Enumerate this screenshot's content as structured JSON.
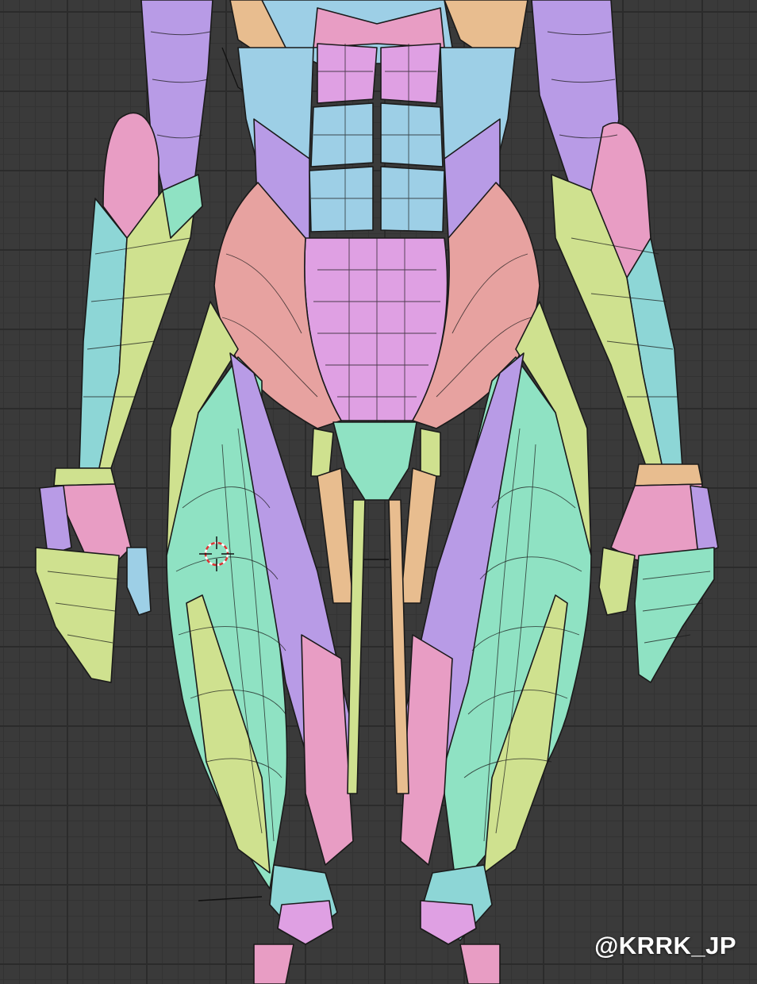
{
  "watermark": "@KRRK_JP",
  "colors": {
    "viewport_bg": "#3a3a3a",
    "grid_major": "#2b2b2b",
    "mint": "#8fe2c3",
    "teal": "#8dd6d6",
    "light_blue": "#9dcfe6",
    "violet": "#b89be6",
    "lilac": "#dfa0e3",
    "pink": "#e89dc4",
    "salmon": "#e7a2a0",
    "yellow_green": "#cfe18f",
    "peach": "#e8bd8f"
  }
}
